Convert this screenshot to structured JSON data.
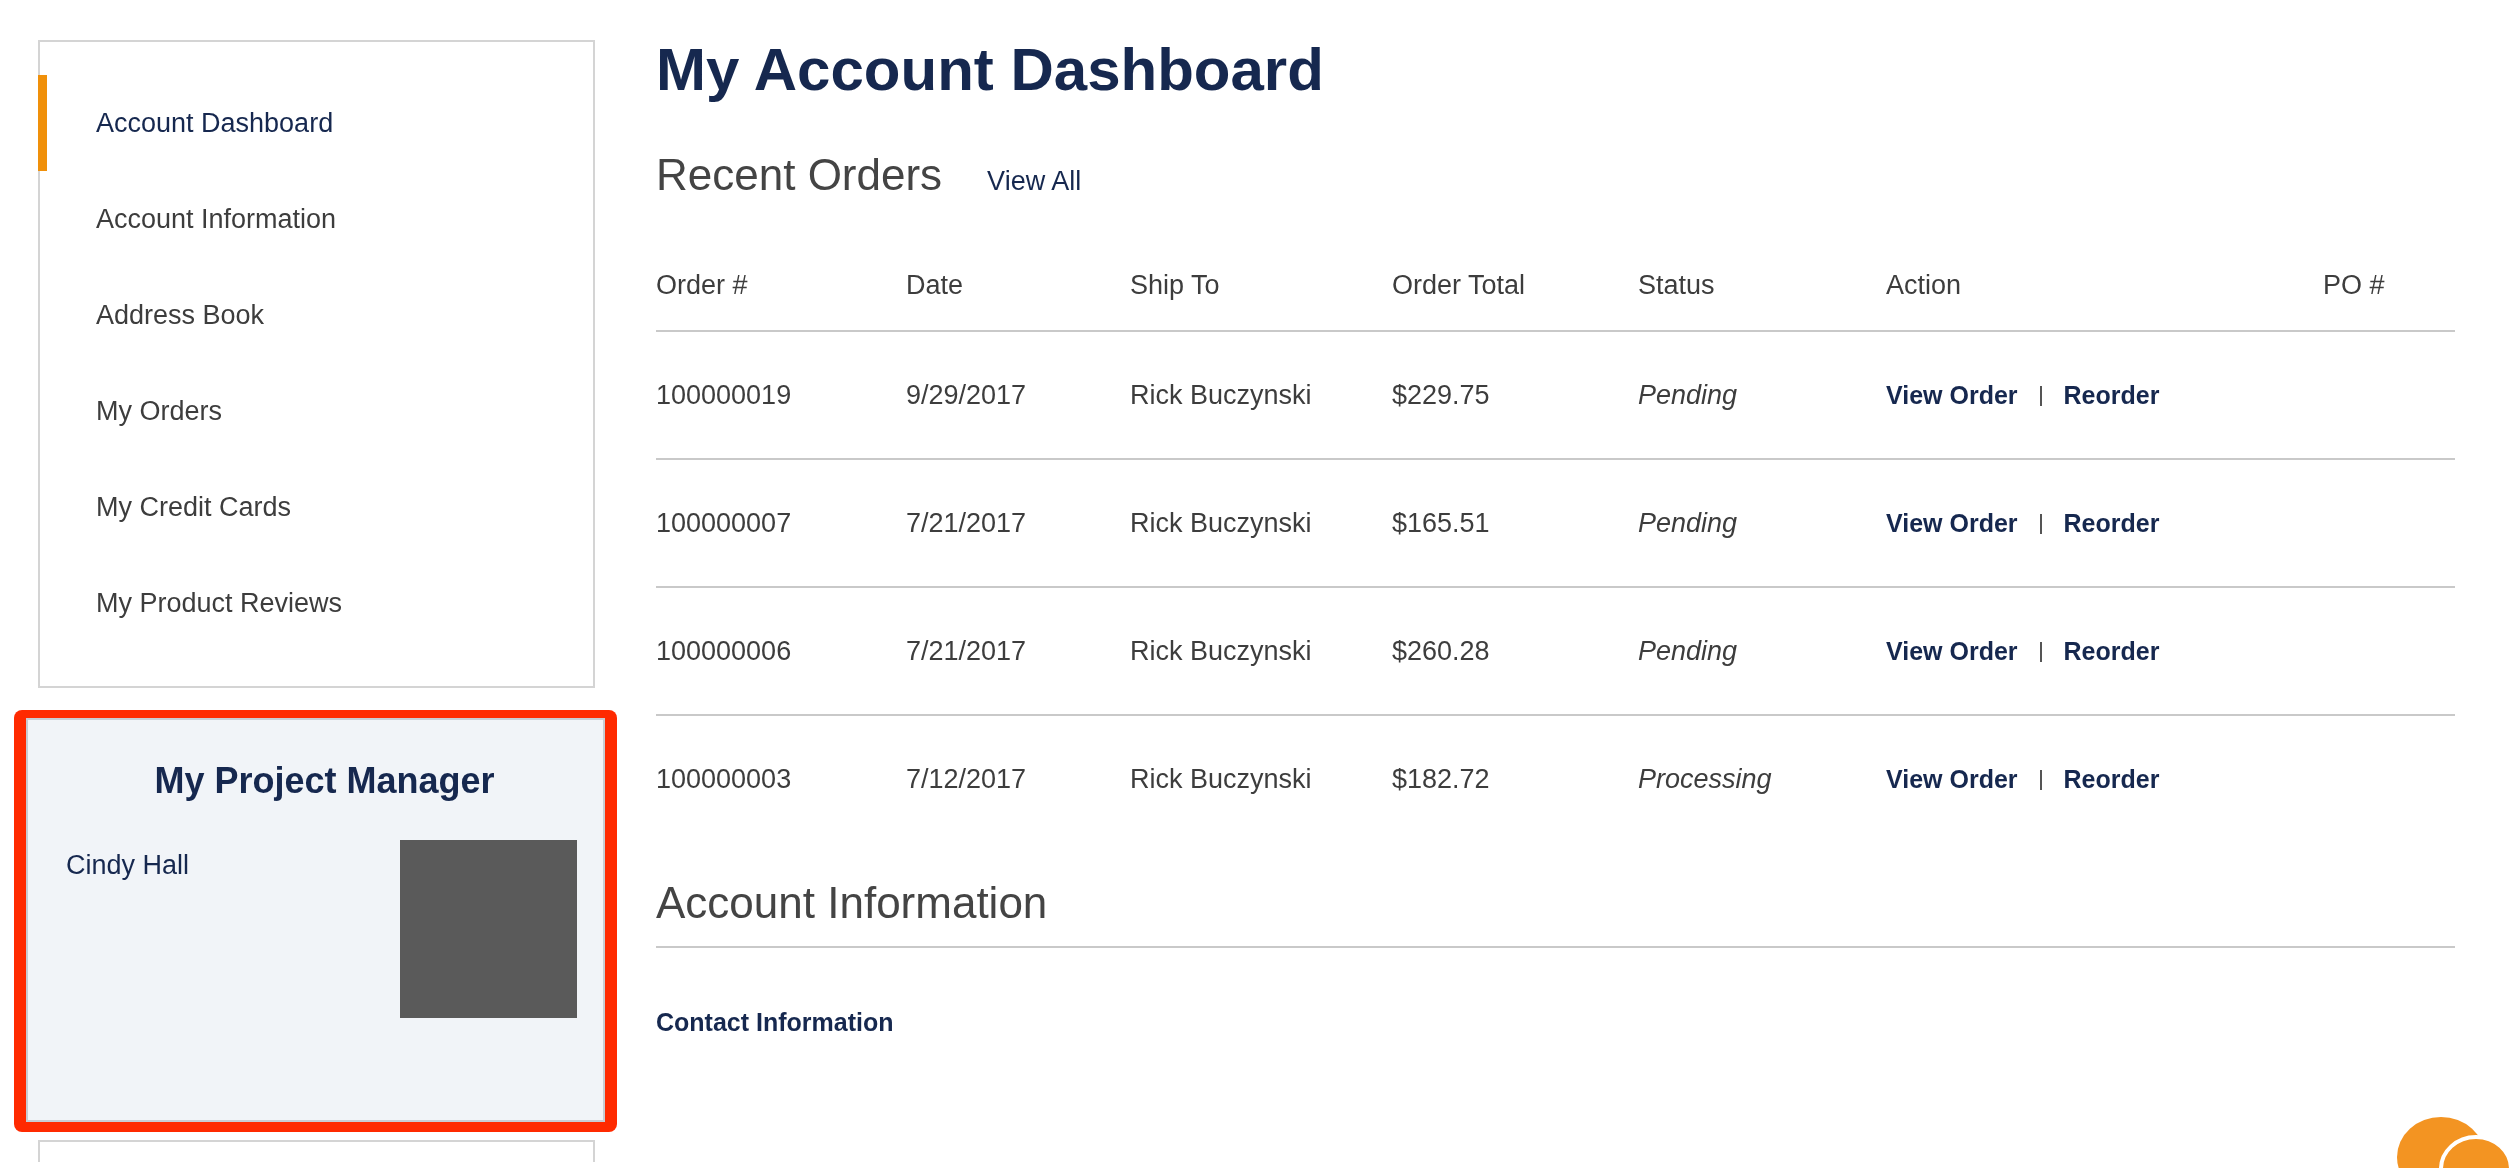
{
  "sidebar": {
    "items": [
      {
        "label": "Account Dashboard",
        "selected": true
      },
      {
        "label": "Account Information",
        "selected": false
      },
      {
        "label": "Address Book",
        "selected": false
      },
      {
        "label": "My Orders",
        "selected": false
      },
      {
        "label": "My Credit Cards",
        "selected": false
      },
      {
        "label": "My Product Reviews",
        "selected": false
      }
    ]
  },
  "project_manager": {
    "title": "My Project Manager",
    "name": "Cindy Hall",
    "highlighted": true
  },
  "page_title": "My Account Dashboard",
  "recent_orders": {
    "title": "Recent Orders",
    "view_all": "View All",
    "columns": [
      "Order #",
      "Date",
      "Ship To",
      "Order Total",
      "Status",
      "Action",
      "PO #"
    ],
    "rows": [
      {
        "order": "100000019",
        "date": "9/29/2017",
        "ship_to": "Rick Buczynski",
        "total": "$229.75",
        "status": "Pending",
        "actions": [
          "View Order",
          "Reorder"
        ]
      },
      {
        "order": "100000007",
        "date": "7/21/2017",
        "ship_to": "Rick Buczynski",
        "total": "$165.51",
        "status": "Pending",
        "actions": [
          "View Order",
          "Reorder"
        ]
      },
      {
        "order": "100000006",
        "date": "7/21/2017",
        "ship_to": "Rick Buczynski",
        "total": "$260.28",
        "status": "Pending",
        "actions": [
          "View Order",
          "Reorder"
        ]
      },
      {
        "order": "100000003",
        "date": "7/12/2017",
        "ship_to": "Rick Buczynski",
        "total": "$182.72",
        "status": "Processing",
        "actions": [
          "View Order",
          "Reorder"
        ]
      }
    ]
  },
  "account_information": {
    "title": "Account Information",
    "subtitle": "Contact Information"
  }
}
